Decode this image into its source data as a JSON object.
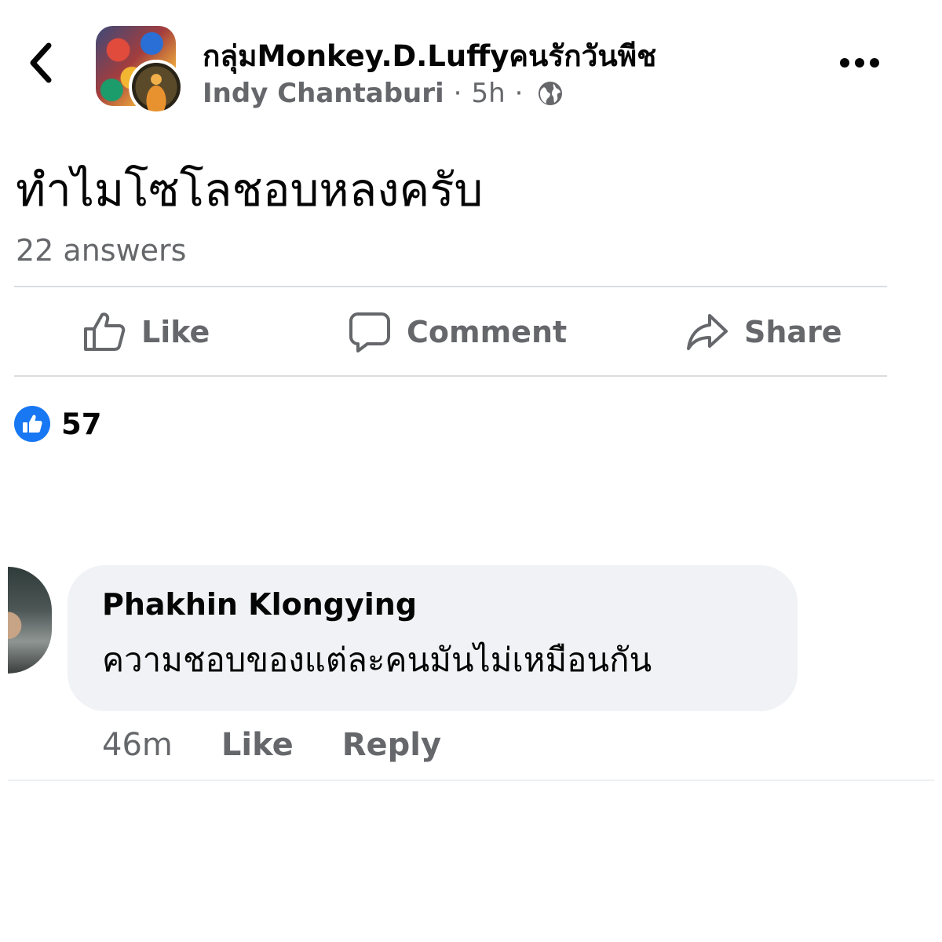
{
  "header": {
    "group_name": "กลุ่มMonkey.D.Luffyคนรักวันพีช",
    "author": "Indy Chantaburi",
    "separator": "·",
    "time": "5h",
    "privacy_icon": "globe-icon",
    "back_icon": "chevron-left-icon",
    "more_icon": "more-horizontal-icon"
  },
  "post": {
    "text": "ทำไมโซโลชอบหลงครับ",
    "answers": "22 answers"
  },
  "actions": {
    "like": "Like",
    "comment": "Comment",
    "share": "Share"
  },
  "reactions": {
    "icon": "like-reaction-icon",
    "count": "57"
  },
  "comment": {
    "author": "Phakhin Klongying",
    "text": "ความชอบของแต่ละคนมันไม่เหมือนกัน",
    "time": "46m",
    "like_label": "Like",
    "reply_label": "Reply"
  },
  "colors": {
    "primary_text": "#050505",
    "secondary_text": "#65676b",
    "accent": "#1877f2",
    "bubble_bg": "#f0f2f5",
    "divider": "#dadde1"
  }
}
